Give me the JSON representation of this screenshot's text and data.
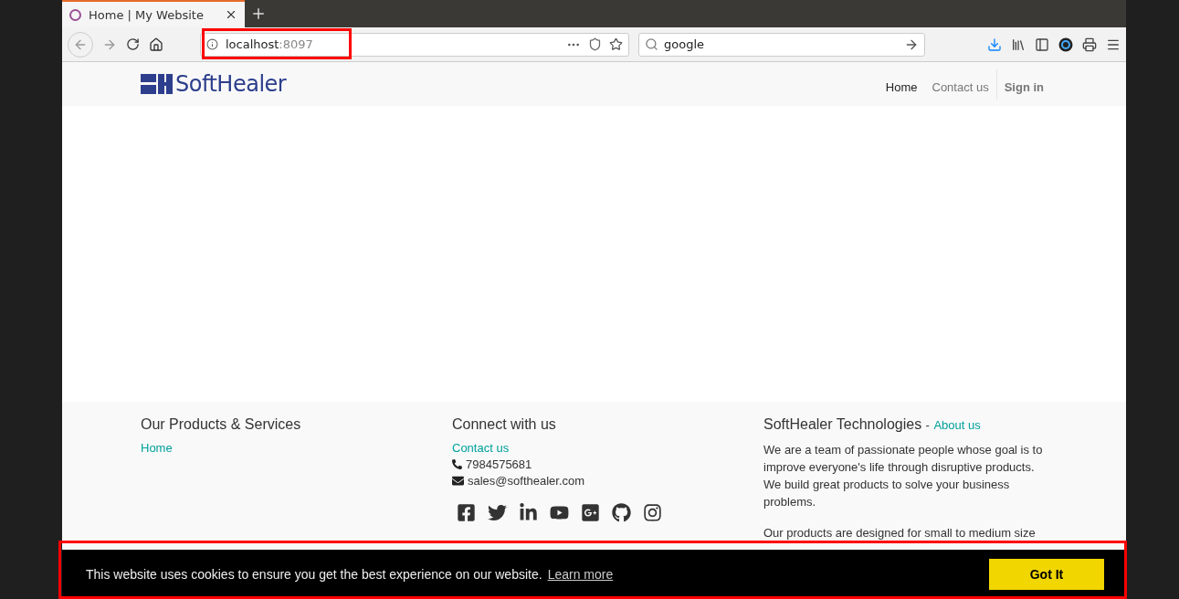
{
  "browser": {
    "tab": {
      "title": "Home | My Website"
    },
    "address": {
      "host": "localhost",
      "port": ":8097"
    },
    "search": {
      "value": "google"
    }
  },
  "header": {
    "logo": "SoftHealer",
    "nav": [
      {
        "label": "Home",
        "selected": true
      },
      {
        "label": "Contact us",
        "selected": false
      }
    ],
    "sign_in": "Sign in"
  },
  "footer": {
    "products": {
      "title": "Our Products & Services",
      "links": [
        "Home"
      ]
    },
    "connect": {
      "title": "Connect with us",
      "link": "Contact us",
      "phone": "7984575681",
      "email": "sales@softhealer.com"
    },
    "about": {
      "title": "SoftHealer Technologies",
      "separator": "-",
      "link": "About us",
      "paragraphs": [
        "We are a team of passionate people whose goal is to improve everyone's life through disruptive products. We build great products to solve your business problems.",
        "Our products are designed for small to medium size"
      ]
    }
  },
  "cookie_banner": {
    "message": "This website uses cookies to ensure you get the best experience on our website.",
    "link": "Learn more",
    "button": "Got It"
  }
}
